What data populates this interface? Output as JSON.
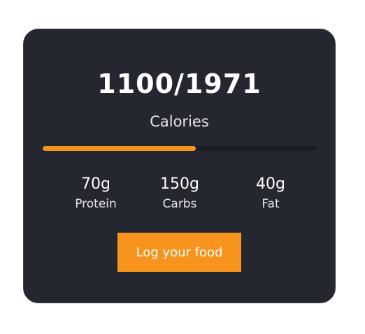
{
  "calories": {
    "total": "1100/1971",
    "unit": "Calories",
    "consumed": 1100,
    "goal": 1971,
    "progress_fraction": 0.558
  },
  "macros": [
    {
      "amount": "70g",
      "label": "Protein"
    },
    {
      "amount": "150g",
      "label": "Carbs"
    },
    {
      "amount": "40g",
      "label": "Fat"
    }
  ],
  "action": {
    "log_label": "Log your food"
  },
  "colors": {
    "card_bg": "#252730",
    "accent": "#f7941d",
    "text": "#ffffff"
  }
}
